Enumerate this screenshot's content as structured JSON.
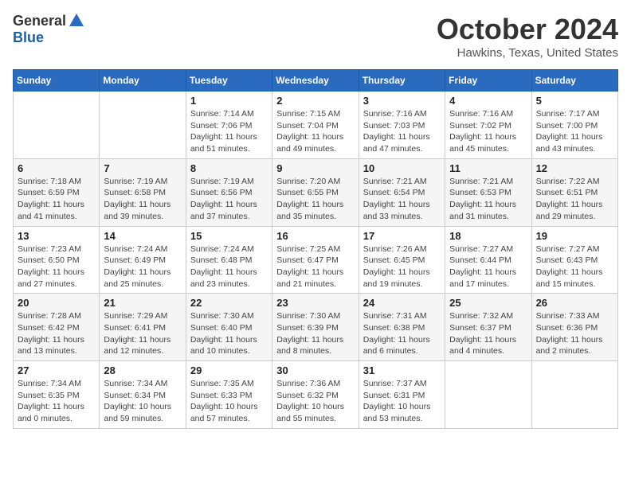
{
  "header": {
    "logo_general": "General",
    "logo_blue": "Blue",
    "title": "October 2024",
    "location": "Hawkins, Texas, United States"
  },
  "days_of_week": [
    "Sunday",
    "Monday",
    "Tuesday",
    "Wednesday",
    "Thursday",
    "Friday",
    "Saturday"
  ],
  "weeks": [
    [
      {
        "day": "",
        "detail": ""
      },
      {
        "day": "",
        "detail": ""
      },
      {
        "day": "1",
        "detail": "Sunrise: 7:14 AM\nSunset: 7:06 PM\nDaylight: 11 hours and 51 minutes."
      },
      {
        "day": "2",
        "detail": "Sunrise: 7:15 AM\nSunset: 7:04 PM\nDaylight: 11 hours and 49 minutes."
      },
      {
        "day": "3",
        "detail": "Sunrise: 7:16 AM\nSunset: 7:03 PM\nDaylight: 11 hours and 47 minutes."
      },
      {
        "day": "4",
        "detail": "Sunrise: 7:16 AM\nSunset: 7:02 PM\nDaylight: 11 hours and 45 minutes."
      },
      {
        "day": "5",
        "detail": "Sunrise: 7:17 AM\nSunset: 7:00 PM\nDaylight: 11 hours and 43 minutes."
      }
    ],
    [
      {
        "day": "6",
        "detail": "Sunrise: 7:18 AM\nSunset: 6:59 PM\nDaylight: 11 hours and 41 minutes."
      },
      {
        "day": "7",
        "detail": "Sunrise: 7:19 AM\nSunset: 6:58 PM\nDaylight: 11 hours and 39 minutes."
      },
      {
        "day": "8",
        "detail": "Sunrise: 7:19 AM\nSunset: 6:56 PM\nDaylight: 11 hours and 37 minutes."
      },
      {
        "day": "9",
        "detail": "Sunrise: 7:20 AM\nSunset: 6:55 PM\nDaylight: 11 hours and 35 minutes."
      },
      {
        "day": "10",
        "detail": "Sunrise: 7:21 AM\nSunset: 6:54 PM\nDaylight: 11 hours and 33 minutes."
      },
      {
        "day": "11",
        "detail": "Sunrise: 7:21 AM\nSunset: 6:53 PM\nDaylight: 11 hours and 31 minutes."
      },
      {
        "day": "12",
        "detail": "Sunrise: 7:22 AM\nSunset: 6:51 PM\nDaylight: 11 hours and 29 minutes."
      }
    ],
    [
      {
        "day": "13",
        "detail": "Sunrise: 7:23 AM\nSunset: 6:50 PM\nDaylight: 11 hours and 27 minutes."
      },
      {
        "day": "14",
        "detail": "Sunrise: 7:24 AM\nSunset: 6:49 PM\nDaylight: 11 hours and 25 minutes."
      },
      {
        "day": "15",
        "detail": "Sunrise: 7:24 AM\nSunset: 6:48 PM\nDaylight: 11 hours and 23 minutes."
      },
      {
        "day": "16",
        "detail": "Sunrise: 7:25 AM\nSunset: 6:47 PM\nDaylight: 11 hours and 21 minutes."
      },
      {
        "day": "17",
        "detail": "Sunrise: 7:26 AM\nSunset: 6:45 PM\nDaylight: 11 hours and 19 minutes."
      },
      {
        "day": "18",
        "detail": "Sunrise: 7:27 AM\nSunset: 6:44 PM\nDaylight: 11 hours and 17 minutes."
      },
      {
        "day": "19",
        "detail": "Sunrise: 7:27 AM\nSunset: 6:43 PM\nDaylight: 11 hours and 15 minutes."
      }
    ],
    [
      {
        "day": "20",
        "detail": "Sunrise: 7:28 AM\nSunset: 6:42 PM\nDaylight: 11 hours and 13 minutes."
      },
      {
        "day": "21",
        "detail": "Sunrise: 7:29 AM\nSunset: 6:41 PM\nDaylight: 11 hours and 12 minutes."
      },
      {
        "day": "22",
        "detail": "Sunrise: 7:30 AM\nSunset: 6:40 PM\nDaylight: 11 hours and 10 minutes."
      },
      {
        "day": "23",
        "detail": "Sunrise: 7:30 AM\nSunset: 6:39 PM\nDaylight: 11 hours and 8 minutes."
      },
      {
        "day": "24",
        "detail": "Sunrise: 7:31 AM\nSunset: 6:38 PM\nDaylight: 11 hours and 6 minutes."
      },
      {
        "day": "25",
        "detail": "Sunrise: 7:32 AM\nSunset: 6:37 PM\nDaylight: 11 hours and 4 minutes."
      },
      {
        "day": "26",
        "detail": "Sunrise: 7:33 AM\nSunset: 6:36 PM\nDaylight: 11 hours and 2 minutes."
      }
    ],
    [
      {
        "day": "27",
        "detail": "Sunrise: 7:34 AM\nSunset: 6:35 PM\nDaylight: 11 hours and 0 minutes."
      },
      {
        "day": "28",
        "detail": "Sunrise: 7:34 AM\nSunset: 6:34 PM\nDaylight: 10 hours and 59 minutes."
      },
      {
        "day": "29",
        "detail": "Sunrise: 7:35 AM\nSunset: 6:33 PM\nDaylight: 10 hours and 57 minutes."
      },
      {
        "day": "30",
        "detail": "Sunrise: 7:36 AM\nSunset: 6:32 PM\nDaylight: 10 hours and 55 minutes."
      },
      {
        "day": "31",
        "detail": "Sunrise: 7:37 AM\nSunset: 6:31 PM\nDaylight: 10 hours and 53 minutes."
      },
      {
        "day": "",
        "detail": ""
      },
      {
        "day": "",
        "detail": ""
      }
    ]
  ]
}
